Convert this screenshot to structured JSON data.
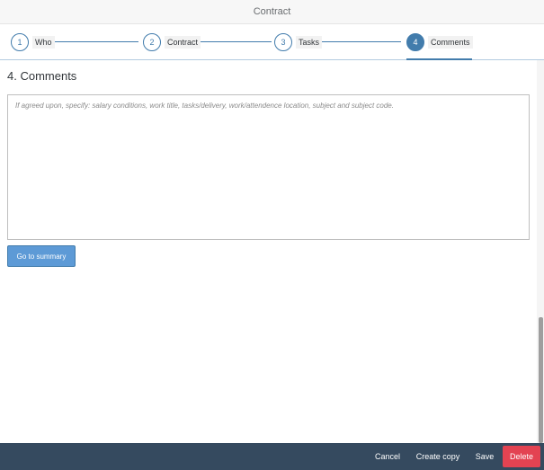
{
  "header": {
    "title": "Contract"
  },
  "wizard": {
    "steps": [
      {
        "number": "1",
        "label": "Who"
      },
      {
        "number": "2",
        "label": "Contract"
      },
      {
        "number": "3",
        "label": "Tasks"
      },
      {
        "number": "4",
        "label": "Comments"
      }
    ],
    "current_step": "4"
  },
  "section": {
    "title": "4. Comments",
    "comments_placeholder": "If agreed upon, specify: salary conditions, work title, tasks/delivery, work/attendence location, subject and subject code.",
    "comments_value": ""
  },
  "actions": {
    "go_to_summary": "Go to summary"
  },
  "footer": {
    "cancel": "Cancel",
    "create_copy": "Create copy",
    "save": "Save",
    "delete": "Delete"
  },
  "colors": {
    "accent": "#427cac",
    "button": "#5d9ad6",
    "footer": "#354a5f",
    "delete": "#e34352"
  }
}
